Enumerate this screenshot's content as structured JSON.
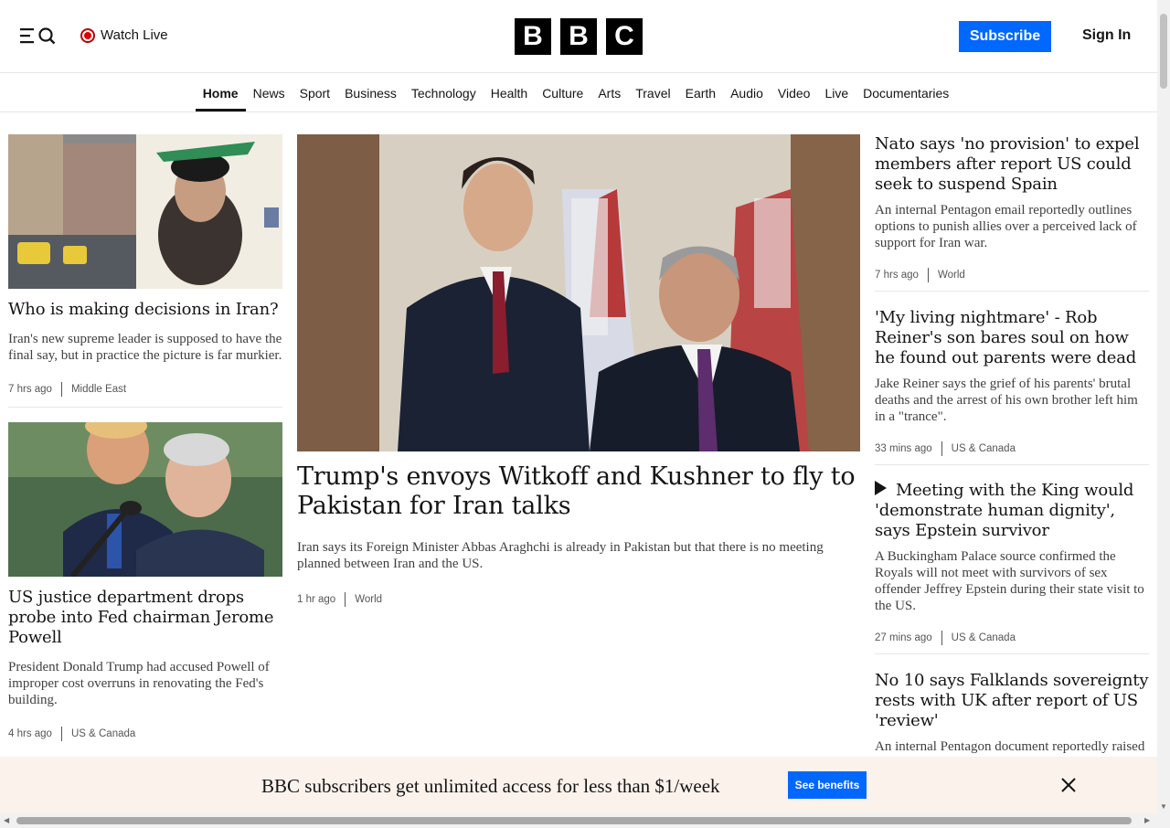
{
  "header": {
    "watch_live": "Watch Live",
    "logo": [
      "B",
      "B",
      "C"
    ],
    "subscribe": "Subscribe",
    "sign_in": "Sign In"
  },
  "nav": {
    "items": [
      "Home",
      "News",
      "Sport",
      "Business",
      "Technology",
      "Health",
      "Culture",
      "Arts",
      "Travel",
      "Earth",
      "Audio",
      "Video",
      "Live",
      "Documentaries"
    ],
    "active": "Home"
  },
  "left": [
    {
      "headline": "Who is making decisions in Iran?",
      "summary": "Iran's new supreme leader is supposed to have the final say, but in practice the picture is far murkier.",
      "time": "7 hrs ago",
      "category": "Middle East"
    },
    {
      "headline": "US justice department drops probe into Fed chairman Jerome Powell",
      "summary": "President Donald Trump had accused Powell of improper cost overruns in renovating the Fed's building.",
      "time": "4 hrs ago",
      "category": "US & Canada"
    }
  ],
  "center": {
    "headline": "Trump's envoys Witkoff and Kushner to fly to Pakistan for Iran talks",
    "summary": "Iran says its Foreign Minister Abbas Araghchi is already in Pakistan but that there is no meeting planned between Iran and the US.",
    "time": "1 hr ago",
    "category": "World"
  },
  "right": [
    {
      "headline": "Nato says 'no provision' to expel members after report US could seek to suspend Spain",
      "summary": "An internal Pentagon email reportedly outlines options to punish allies over a perceived lack of support for Iran war.",
      "time": "7 hrs ago",
      "category": "World"
    },
    {
      "headline": "'My living nightmare' - Rob Reiner's son bares soul on how he found out parents were dead",
      "summary": "Jake Reiner says the grief of his parents' brutal deaths and the arrest of his own brother left him in a \"trance\".",
      "time": "33 mins ago",
      "category": "US & Canada"
    },
    {
      "headline": "Meeting with the King would 'demonstrate human dignity', says Epstein survivor",
      "summary": "A Buckingham Palace source confirmed the Royals will not meet with survivors of sex offender Jeffrey Epstein during their state visit to the US.",
      "time": "27 mins ago",
      "category": "US & Canada",
      "video": true
    },
    {
      "headline": "No 10 says Falklands sovereignty rests with UK after report of US 'review'",
      "summary": "An internal Pentagon document reportedly raised the prospect of a change in position"
    }
  ],
  "banner": {
    "text": "BBC subscribers get unlimited access for less than $1/week",
    "button": "See benefits"
  },
  "colors": {
    "accent": "#0068ff",
    "live": "#d00000",
    "banner_bg": "#fbf2ec"
  }
}
